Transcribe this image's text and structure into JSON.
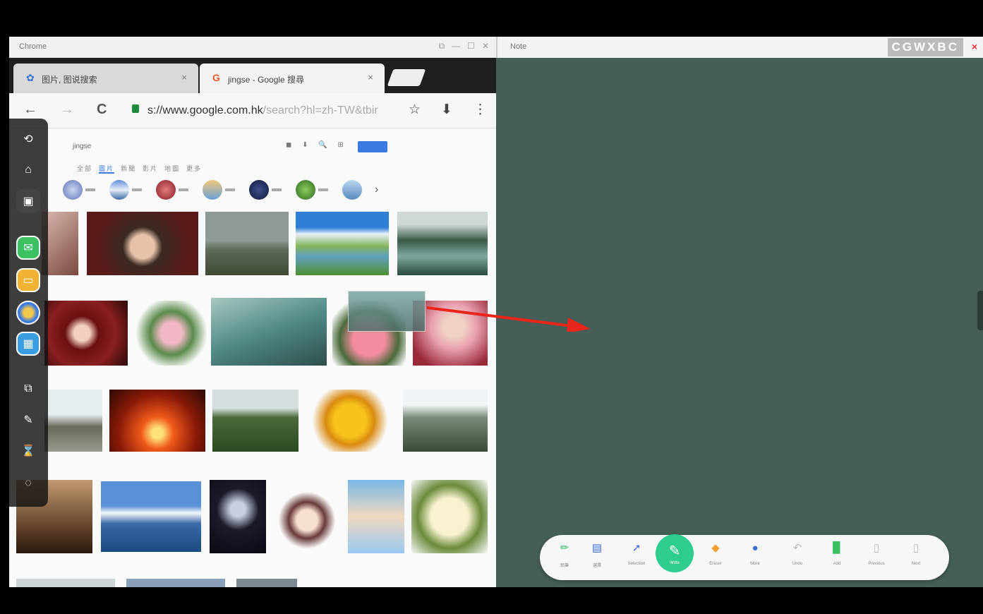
{
  "chrome": {
    "window_title": "Chrome",
    "tabs": [
      {
        "label": "图片, 图说搜索",
        "close": "×"
      },
      {
        "label": "jingse - Google 搜尋",
        "close": "×"
      }
    ],
    "url_main": "s://www.google.com.hk",
    "url_dim": "/search?hl=zh-TW&tbir",
    "search_query": "jingse",
    "nav": {
      "back": "←",
      "forward": "→",
      "reload": "C"
    },
    "actions": {
      "star": "☆",
      "download": "⬇",
      "menu": "⋮"
    },
    "result_tabs": [
      "全部",
      "圖片",
      "新聞",
      "影片",
      "地圖",
      "更多"
    ],
    "selected_result_tab": "圖片"
  },
  "dock": {
    "icons": [
      "back-icon",
      "home-icon",
      "window-icon",
      "messages-app-icon",
      "files-app-icon",
      "browser-app-icon",
      "apps-grid-icon",
      "whiteboard-icon",
      "pen-icon",
      "hourglass-icon",
      "settings-icon"
    ]
  },
  "note": {
    "window_title": "Note",
    "keys": "CGWXBC",
    "close": "×"
  },
  "toolbar": {
    "tools": [
      {
        "label": "鉛筆",
        "icon": "pencil-icon"
      },
      {
        "label": "選擇",
        "icon": "select-icon"
      },
      {
        "label": "Selection",
        "icon": "cursor-icon"
      },
      {
        "label": "Write",
        "icon": "pen-active-icon"
      },
      {
        "label": "Eraser",
        "icon": "eraser-icon"
      },
      {
        "label": "More",
        "icon": "more-icon"
      },
      {
        "label": "Undo",
        "icon": "undo-icon"
      },
      {
        "label": "Add",
        "icon": "add-page-icon"
      },
      {
        "label": "Previous",
        "icon": "prev-page-icon"
      },
      {
        "label": "Next",
        "icon": "next-page-icon"
      }
    ]
  },
  "colors": {
    "note_bg": "#455f57",
    "accent": "#2ecc8e",
    "arrow": "#e8261c",
    "link_blue": "#3b7be0"
  }
}
